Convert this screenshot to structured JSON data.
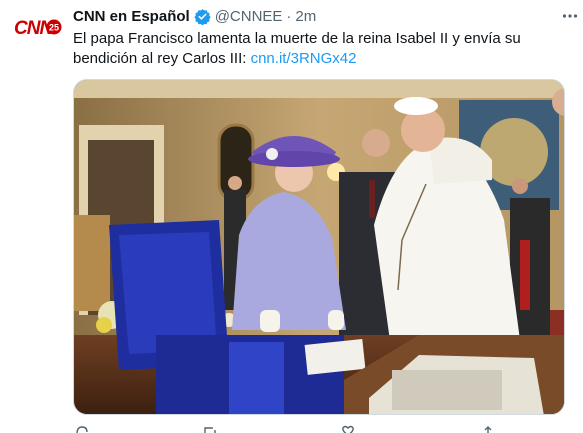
{
  "tweet": {
    "author_name": "CNN en Español",
    "handle": "@CNNEE",
    "separator": "·",
    "time": "2m",
    "text": "El papa Francisco lamenta la muerte de la reina Isabel II y envía su bendición al rey Carlos III:",
    "link": "cnn.it/3RNGx42"
  },
  "avatar": {
    "logo": "CNN",
    "badge": "25"
  },
  "icons": {
    "verified": "verified-badge-icon",
    "more": "more-options-icon",
    "reply": "reply-icon",
    "retweet": "retweet-icon",
    "like": "like-icon",
    "share": "share-icon"
  },
  "colors": {
    "brand_red": "#cc0000",
    "verified_blue": "#1d9bf0",
    "link": "#1d9bf0"
  }
}
